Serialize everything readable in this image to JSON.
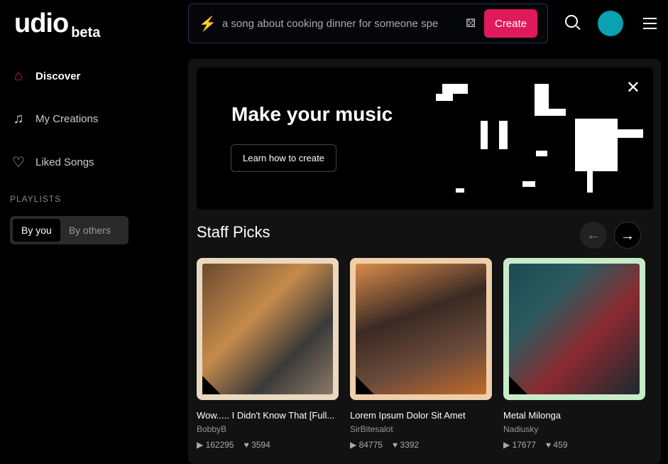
{
  "logo": {
    "name": "udio",
    "tag": "beta"
  },
  "prompt": {
    "value": "a song about cooking dinner for someone spe",
    "create_label": "Create"
  },
  "sidebar": {
    "items": [
      {
        "label": "Discover",
        "icon": "home-icon"
      },
      {
        "label": "My Creations",
        "icon": "music-note-icon"
      },
      {
        "label": "Liked Songs",
        "icon": "heart-icon"
      }
    ],
    "playlists_label": "PLAYLISTS",
    "tabs": [
      "By you",
      "By others"
    ]
  },
  "banner": {
    "title": "Make your music",
    "button": "Learn how to create"
  },
  "staff_picks": {
    "title": "Staff Picks",
    "cards": [
      {
        "title": "Wow..... I Didn't Know That [Full...",
        "artist": "BobbyB",
        "plays": "162295",
        "likes": "3594",
        "frame": "#e8d9c0"
      },
      {
        "title": "Lorem Ipsum Dolor Sit Amet",
        "artist": "SirBitesalot",
        "plays": "84775",
        "likes": "3392",
        "frame": "#efcfaa"
      },
      {
        "title": "Metal Milonga",
        "artist": "Nadiusky",
        "plays": "17677",
        "likes": "459",
        "frame": "#c7ebc9"
      }
    ]
  },
  "colors": {
    "accent": "#e0195a",
    "avatar": "#0aa1b0"
  }
}
